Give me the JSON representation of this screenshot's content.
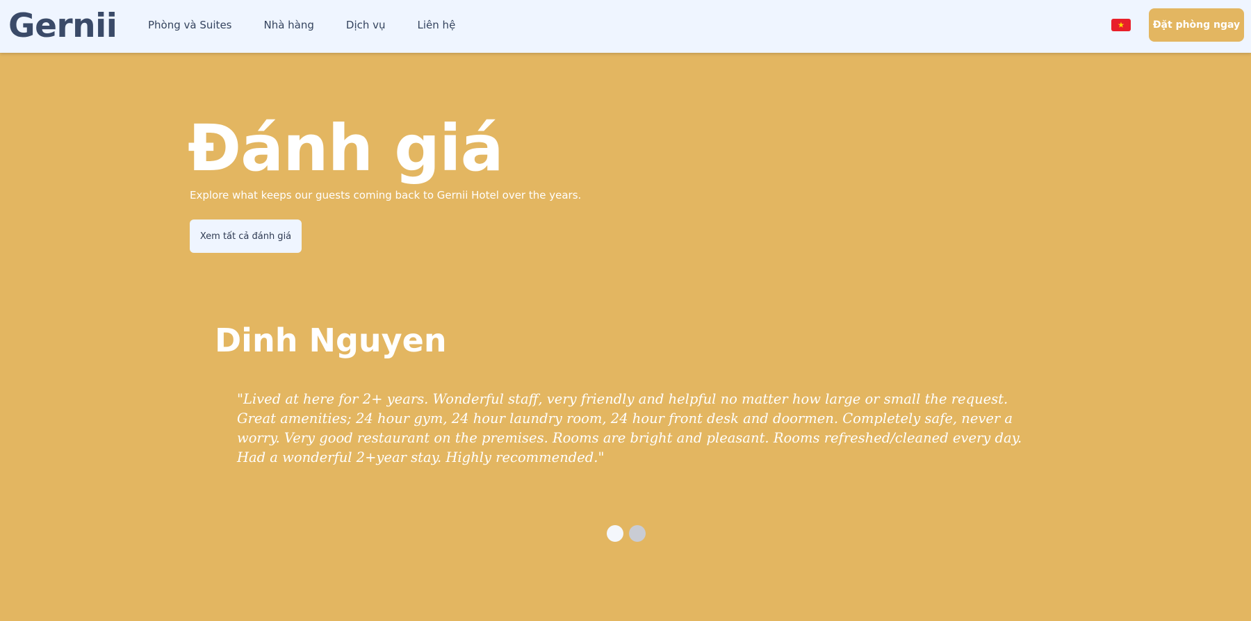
{
  "brand": {
    "logo_text": "Gernii"
  },
  "nav": {
    "links": [
      {
        "label": "Phòng và Suites"
      },
      {
        "label": "Nhà hàng"
      },
      {
        "label": "Dịch vụ"
      },
      {
        "label": "Liên hệ"
      }
    ],
    "language_flag": "vietnam-flag-icon",
    "book_button": "Đặt phòng ngay"
  },
  "hero": {
    "title": "Đánh giá",
    "subtitle": "Explore what keeps our guests coming back to Gernii Hotel over the years.",
    "view_all_button": "Xem tất cả đánh giá"
  },
  "review": {
    "reviewer": "Dinh Nguyen",
    "quote": "\"Lived at here for 2+ years. Wonderful staff, very friendly and helpful no matter how large or small the request. Great amenities; 24 hour gym, 24 hour laundry room, 24 hour front desk and doormen. Completely safe, never a worry. Very good restaurant on the premises. Rooms are bright and pleasant. Rooms refreshed/cleaned every day. Had a wonderful 2+year stay. Highly recommended.\""
  },
  "carousel": {
    "dot_count": 2,
    "active_index": 0
  },
  "colors": {
    "background": "#e3b661",
    "navbar": "#eff5ff",
    "logo": "#3a4a68",
    "accent": "#e3b661",
    "flag_red": "#e8202a",
    "flag_star": "#ffde00"
  }
}
